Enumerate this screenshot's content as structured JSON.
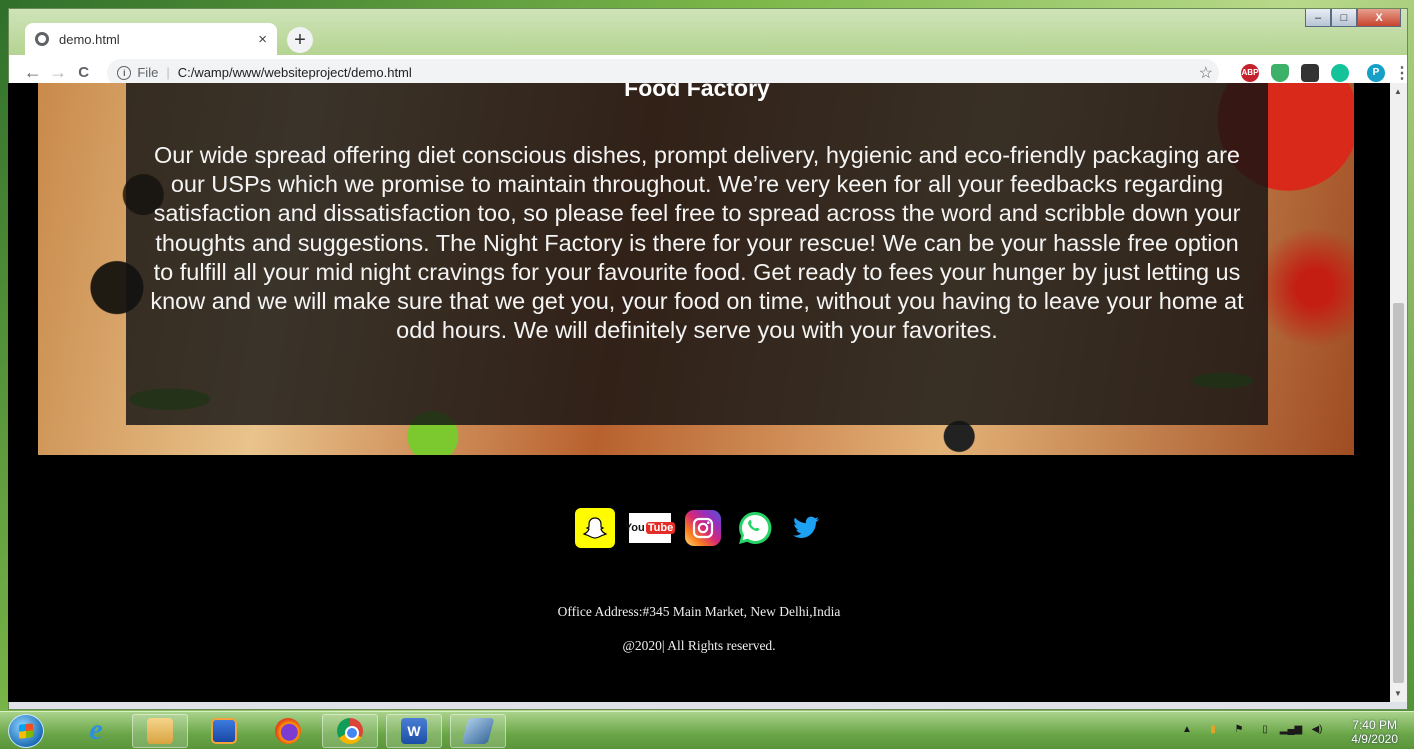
{
  "browser": {
    "tab_title": "demo.html",
    "tab_close": "×",
    "new_tab": "+",
    "back": "←",
    "forward": "→",
    "reload": "C",
    "info": "i",
    "file_label": "File",
    "url": "C:/wamp/www/websiteproject/demo.html",
    "bookmark_star": "☆",
    "extensions": [
      "ABP",
      "",
      "",
      "",
      "P"
    ],
    "menu": "⋮",
    "window_controls": [
      "–",
      "□",
      "X"
    ]
  },
  "page": {
    "hero": {
      "title": "Food Factory",
      "paragraph": "Our wide spread offering diet conscious dishes, prompt delivery, hygienic and eco-friendly packaging are our USPs which we promise to maintain throughout. We’re very keen for all your feedbacks regarding satisfaction and dissatisfaction too, so please feel free to spread across the word and scribble down your thoughts and suggestions. The Night Factory is there for your rescue! We can be your hassle free option to fulfill all your mid night cravings for your favourite food. Get ready to fees your hunger by just letting us know and we will make sure that we get you, your food on time, without you having to leave your home at odd hours. We will definitely serve you with your favorites."
    },
    "social": {
      "youtube_you": "You",
      "youtube_tube": "Tube"
    },
    "footer": {
      "address": "Office Address:#345 Main Market, New Delhi,India",
      "copyright": "@2020| All Rights reserved."
    }
  },
  "taskbar": {
    "word_label": "W",
    "ie_label": "e",
    "clock_time": "7:40 PM",
    "clock_date": "4/9/2020"
  },
  "colors": {
    "page_background": "#000000",
    "overlay": "#141414",
    "snapchat": "#fffc00",
    "twitter": "#1da1f2",
    "whatsapp": "#25d366"
  }
}
